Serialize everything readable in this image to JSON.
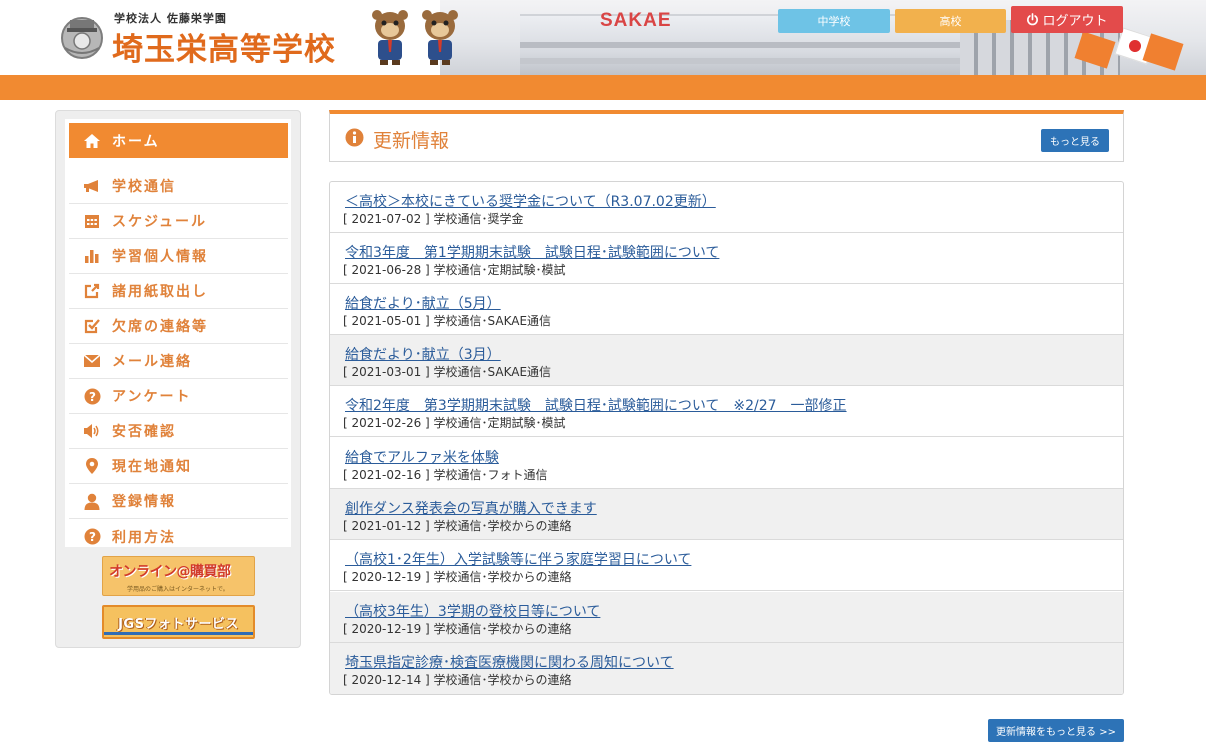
{
  "header": {
    "school_subtitle": "学校法人 佐藤栄学園",
    "school_name": "埼玉栄高等学校",
    "building_sign": "SAKAE",
    "buttons": {
      "junior_high": "中学校",
      "high_school": "高校",
      "logout": "ログアウト"
    },
    "colors": {
      "orange_bar": "#f18a31",
      "junior_high": "#6ec3e6",
      "high_school": "#f2b14d",
      "logout": "#e34b4b"
    }
  },
  "sidebar": {
    "items": [
      {
        "label": "ホーム",
        "icon": "home-icon",
        "active": true
      },
      {
        "label": "学校通信",
        "icon": "megaphone-icon"
      },
      {
        "label": "スケジュール",
        "icon": "calendar-icon"
      },
      {
        "label": "学習個人情報",
        "icon": "bar-chart-icon"
      },
      {
        "label": "諸用紙取出し",
        "icon": "export-icon"
      },
      {
        "label": "欠席の連絡等",
        "icon": "checkbox-icon"
      },
      {
        "label": "メール連絡",
        "icon": "envelope-icon"
      },
      {
        "label": "アンケート",
        "icon": "question-icon"
      },
      {
        "label": "安否確認",
        "icon": "speaker-icon"
      },
      {
        "label": "現在地通知",
        "icon": "map-pin-icon"
      },
      {
        "label": "登録情報",
        "icon": "user-icon"
      },
      {
        "label": "利用方法",
        "icon": "question-icon"
      }
    ],
    "banners": {
      "online": {
        "title": "オンライン@購買部",
        "sub": "学用品のご購入はインターネットで。"
      },
      "photo": {
        "title": "JGSフォトサービス"
      }
    }
  },
  "main": {
    "section_title": "更新情報",
    "more_label": "もっと見る",
    "more_bottom_label": "更新情報をもっと見る >>",
    "news": [
      {
        "title": "＜高校＞本校にきている奨学金について（R3.07.02更新）",
        "meta": "[ 2021-07-02 ] 学校通信･奨学金",
        "shaded": false
      },
      {
        "title": "令和3年度　第1学期期末試験　試験日程･試験範囲について",
        "meta": "[ 2021-06-28 ] 学校通信･定期試験･模試",
        "shaded": false
      },
      {
        "title": "給食だより･献立（5月）",
        "meta": "[ 2021-05-01 ] 学校通信･SAKAE通信",
        "shaded": false
      },
      {
        "title": "給食だより･献立（3月）",
        "meta": "[ 2021-03-01 ] 学校通信･SAKAE通信",
        "shaded": true
      },
      {
        "title": "令和2年度　第3学期期末試験　試験日程･試験範囲について　※2/27　一部修正",
        "meta": "[ 2021-02-26 ] 学校通信･定期試験･模試",
        "shaded": false
      },
      {
        "title": "給食でアルファ米を体験",
        "meta": "[ 2021-02-16 ] 学校通信･フォト通信",
        "shaded": false
      },
      {
        "title": "創作ダンス発表会の写真が購入できます",
        "meta": "[ 2021-01-12 ] 学校通信･学校からの連絡",
        "shaded": true
      },
      {
        "title": "（高校1･2年生）入学試験等に伴う家庭学習日について",
        "meta": "[ 2020-12-19 ] 学校通信･学校からの連絡",
        "shaded": false
      },
      {
        "title": "（高校3年生）3学期の登校日等について",
        "meta": "[ 2020-12-19 ] 学校通信･学校からの連絡",
        "shaded": true
      },
      {
        "title": "埼玉県指定診療･検査医療機関に関わる周知について",
        "meta": "[ 2020-12-14 ] 学校通信･学校からの連絡",
        "shaded": true
      }
    ]
  }
}
